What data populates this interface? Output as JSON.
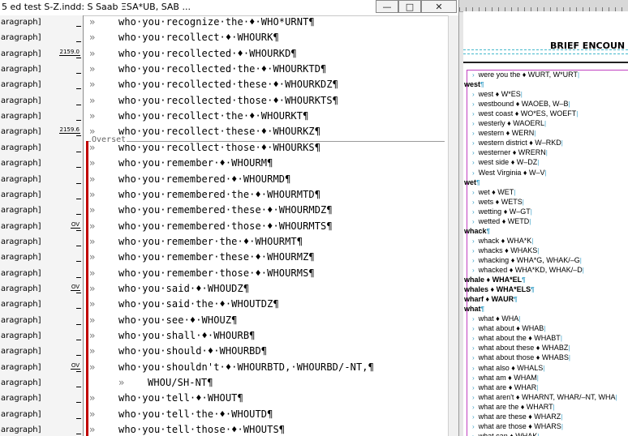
{
  "window": {
    "title": "5 ed test S-Z.indd: S Saab ΞSA*UB, SAB ...",
    "minimize_glyph": "—",
    "maximize_glyph": "□",
    "close_glyph": "✕"
  },
  "story": {
    "overset_label": "Overset",
    "rows": [
      {
        "style": "aragraph]",
        "depth": "",
        "text": "who·you·recognize·the·♦·WHO*URNT¶",
        "indent": false
      },
      {
        "style": "aragraph]",
        "depth": "",
        "text": "who·you·recollect·♦·WHOURK¶",
        "indent": false
      },
      {
        "style": "aragraph]",
        "depth": "2159.0",
        "text": "who·you·recollected·♦·WHOURKD¶",
        "indent": false
      },
      {
        "style": "aragraph]",
        "depth": "",
        "text": "who·you·recollected·the·♦·WHOURKTD¶",
        "indent": false
      },
      {
        "style": "aragraph]",
        "depth": "",
        "text": "who·you·recollected·these·♦·WHOURKDZ¶",
        "indent": false
      },
      {
        "style": "aragraph]",
        "depth": "",
        "text": "who·you·recollected·those·♦·WHOURKTS¶",
        "indent": false
      },
      {
        "style": "aragraph]",
        "depth": "",
        "text": "who·you·recollect·the·♦·WHOURKT¶",
        "indent": false
      },
      {
        "style": "aragraph]",
        "depth": "2159.6",
        "text": "who·you·recollect·these·♦·WHOURKZ¶",
        "indent": false
      },
      {
        "style": "aragraph]",
        "depth": "",
        "text": "who·you·recollect·those·♦·WHOURKS¶",
        "indent": false
      },
      {
        "style": "aragraph]",
        "depth": "",
        "text": "who·you·remember·♦·WHOURM¶",
        "indent": false
      },
      {
        "style": "aragraph]",
        "depth": "",
        "text": "who·you·remembered·♦·WHOURMD¶",
        "indent": false
      },
      {
        "style": "aragraph]",
        "depth": "",
        "text": "who·you·remembered·the·♦·WHOURMTD¶",
        "indent": false
      },
      {
        "style": "aragraph]",
        "depth": "",
        "text": "who·you·remembered·these·♦·WHOURMDZ¶",
        "indent": false
      },
      {
        "style": "aragraph]",
        "depth": "OV",
        "text": "who·you·remembered·those·♦·WHOURMTS¶",
        "indent": false
      },
      {
        "style": "aragraph]",
        "depth": "",
        "text": "who·you·remember·the·♦·WHOURMT¶",
        "indent": false
      },
      {
        "style": "aragraph]",
        "depth": "",
        "text": "who·you·remember·these·♦·WHOURMZ¶",
        "indent": false
      },
      {
        "style": "aragraph]",
        "depth": "",
        "text": "who·you·remember·those·♦·WHOURMS¶",
        "indent": false
      },
      {
        "style": "aragraph]",
        "depth": "OV",
        "text": "who·you·said·♦·WHOUDZ¶",
        "indent": false
      },
      {
        "style": "aragraph]",
        "depth": "",
        "text": "who·you·said·the·♦·WHOUTDZ¶",
        "indent": false
      },
      {
        "style": "aragraph]",
        "depth": "",
        "text": "who·you·see·♦·WHOUZ¶",
        "indent": false
      },
      {
        "style": "aragraph]",
        "depth": "",
        "text": "who·you·shall·♦·WHOURB¶",
        "indent": false
      },
      {
        "style": "aragraph]",
        "depth": "",
        "text": "who·you·should·♦·WHOURBD¶",
        "indent": false
      },
      {
        "style": "aragraph]",
        "depth": "OV",
        "text": "who·you·shouldn't·♦·WHOURBTD,·WHOURBD/-NT,¶",
        "indent": false
      },
      {
        "style": "aragraph]",
        "depth": "",
        "text": "WHOU/SH-NT¶",
        "indent": true
      },
      {
        "style": "aragraph]",
        "depth": "",
        "text": "who·you·tell·♦·WHOUT¶",
        "indent": false
      },
      {
        "style": "aragraph]",
        "depth": "",
        "text": "who·you·tell·the·♦·WHOUTD¶",
        "indent": false
      },
      {
        "style": "aragraph]",
        "depth": "",
        "text": "who·you·tell·those·♦·WHOUTS¶",
        "indent": false
      }
    ]
  },
  "layout": {
    "heading": "BRIEF ENCOUN",
    "entries": [
      {
        "kind": "sub",
        "text": "were you the ♦ WURT, W*URT"
      },
      {
        "kind": "head",
        "text": "west"
      },
      {
        "kind": "sub",
        "text": "west ♦ W*ES"
      },
      {
        "kind": "sub",
        "text": "westbound ♦ WAOEB, W–B"
      },
      {
        "kind": "sub",
        "text": "west coast ♦ WO*ES, WOEFT"
      },
      {
        "kind": "sub",
        "text": "westerly ♦ WAOERL"
      },
      {
        "kind": "sub",
        "text": "western ♦ WERN"
      },
      {
        "kind": "sub",
        "text": "western district ♦ W–RKD"
      },
      {
        "kind": "sub",
        "text": "westerner ♦ WRERN"
      },
      {
        "kind": "sub",
        "text": "west side ♦ W–DZ"
      },
      {
        "kind": "sub",
        "text": "West Virginia ♦ W–V"
      },
      {
        "kind": "head",
        "text": "wet"
      },
      {
        "kind": "sub",
        "text": "wet ♦ WET"
      },
      {
        "kind": "sub",
        "text": "wets ♦ WETS"
      },
      {
        "kind": "sub",
        "text": "wetting ♦ W–GT"
      },
      {
        "kind": "sub",
        "text": "wetted ♦ WETD"
      },
      {
        "kind": "head",
        "text": "whack"
      },
      {
        "kind": "sub",
        "text": "whack ♦ WHA*K"
      },
      {
        "kind": "sub",
        "text": "whacks ♦ WHAKS"
      },
      {
        "kind": "sub",
        "text": "whacking ♦ WHA*G, WHAK/–G"
      },
      {
        "kind": "sub",
        "text": "whacked ♦ WHA*KD, WHAK/–D"
      },
      {
        "kind": "head",
        "text": "whale ♦ WHA*EL"
      },
      {
        "kind": "head",
        "text": "whales ♦ WHA*ELS"
      },
      {
        "kind": "head",
        "text": "wharf ♦ WAUR"
      },
      {
        "kind": "head",
        "text": "what"
      },
      {
        "kind": "sub",
        "text": "what ♦ WHA"
      },
      {
        "kind": "sub",
        "text": "what about ♦ WHAB"
      },
      {
        "kind": "sub",
        "text": "what about the ♦ WHABT"
      },
      {
        "kind": "sub",
        "text": "what about these ♦ WHABZ"
      },
      {
        "kind": "sub",
        "text": "what about those ♦ WHABS"
      },
      {
        "kind": "sub",
        "text": "what also ♦ WHALS"
      },
      {
        "kind": "sub",
        "text": "what am ♦ WHAM"
      },
      {
        "kind": "sub",
        "text": "what are ♦ WHAR"
      },
      {
        "kind": "sub",
        "text": "what aren't ♦ WHARNT, WHAR/–NT, WHA"
      },
      {
        "kind": "sub",
        "text": "what are the ♦ WHART"
      },
      {
        "kind": "sub",
        "text": "what are these ♦ WHARZ"
      },
      {
        "kind": "sub",
        "text": "what are those ♦ WHARS"
      },
      {
        "kind": "sub",
        "text": "what can ♦ WHAK"
      }
    ]
  },
  "colors": {
    "overset_bar": "#c00000",
    "guide_cyan": "#44b8cc",
    "frame_magenta": "#c040c0"
  }
}
